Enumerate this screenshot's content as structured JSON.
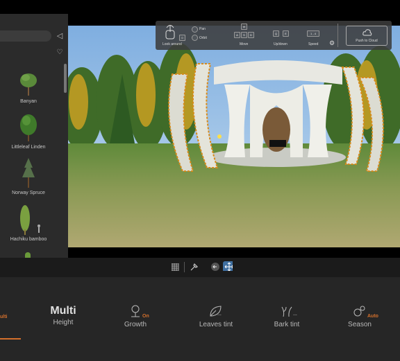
{
  "sidebar": {
    "plants": [
      {
        "name": "Banyan"
      },
      {
        "name": "Littleleaf Linden"
      },
      {
        "name": "Norway Spruce"
      },
      {
        "name": "Hachiku bamboo"
      }
    ]
  },
  "navigation": {
    "look_around": "Look around",
    "pan": "Pan",
    "orbit": "Orbit",
    "move": "Move",
    "updown": "Up/down",
    "speed": "Speed",
    "speed_value": "1 - 4",
    "keys": {
      "w": "W",
      "a": "A",
      "s": "S",
      "d": "D",
      "q": "Q",
      "e": "E",
      "shift": "Shift",
      "ctrl": "Ctrl"
    },
    "push_to_cloud": "Push to Cloud"
  },
  "properties": {
    "multi_tab": "ulti",
    "height_value": "Multi",
    "height_label": "Height",
    "growth_label": "Growth",
    "growth_badge": "On",
    "leaves_label": "Leaves tint",
    "leaves_badge": "...",
    "bark_label": "Bark tint",
    "bark_badge": "...",
    "season_label": "Season",
    "season_badge": "Auto"
  },
  "colors": {
    "accent": "#d4702c",
    "sidebar": "#2b2b2b",
    "panel": "#262626"
  }
}
